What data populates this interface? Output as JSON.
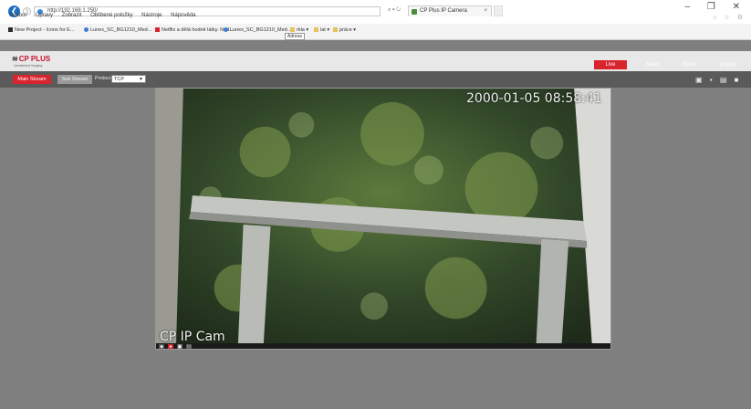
{
  "browser": {
    "address": "http://192.168.1.250/",
    "addr_icons": "⌕ ▾ ↻",
    "tab_title": "CP Plus IP Camera",
    "tab_close": "×",
    "window_controls": "– ❐ ✕",
    "right_icons": "⌂ ☆ ⚙",
    "menu": [
      "Soubor",
      "Úpravy",
      "Zobrazit",
      "Oblíbené položky",
      "Nástroje",
      "Nápověda"
    ],
    "favorites": [
      {
        "label": "New Project - Icons for E...",
        "color": "#2b2b2b"
      },
      {
        "label": "Lunex_SC_BG1210_Med...",
        "color": "#3a7bd5"
      },
      {
        "label": "Netflix a dělá hodně látky. Nad...",
        "color": "#d9232d"
      },
      {
        "label": "Lunex_SC_BG1210_Med...",
        "color": "#3a7bd5"
      },
      {
        "label": "rkla ▾",
        "color": "#e8c35a"
      },
      {
        "label": "lat ▾",
        "color": "#e8c35a"
      },
      {
        "label": "práce ▾",
        "color": "#e8c35a"
      }
    ],
    "tooltip": "Adresa"
  },
  "app": {
    "logo": "CP PLUS",
    "logo_mark": "≋",
    "logo_sub": "Unmatched Imaging",
    "nav": [
      "Live",
      "Setup",
      "Alarm",
      "Logout"
    ],
    "main_stream": "Main Stream",
    "sub_stream": "Sub Stream",
    "protocol_label": "Protocol",
    "protocol_value": "TCP",
    "protocol_arrow": "▼",
    "tool_icons": "▣ ▪ ▤ ■"
  },
  "video": {
    "timestamp": "2000-01-05 08:58:41",
    "camera_name": "CP IP Cam",
    "controls": [
      "■",
      "●",
      "▣",
      "□"
    ]
  },
  "colors": {
    "accent": "#d9232d",
    "page_bg": "#7f7f7f",
    "header_bg": "#e8e8e8"
  }
}
